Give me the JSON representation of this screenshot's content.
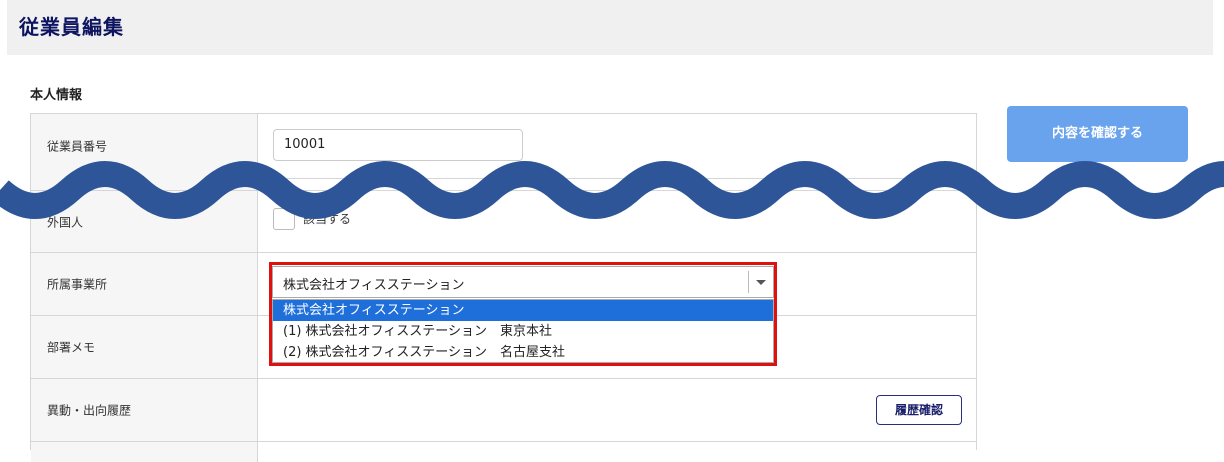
{
  "page": {
    "title": "従業員編集"
  },
  "section": {
    "title": "本人情報"
  },
  "actions": {
    "confirm_label": "内容を確認する"
  },
  "form": {
    "employee_number": {
      "label": "従業員番号",
      "value": "10001"
    },
    "foreigner": {
      "label": "外国人",
      "checkbox_label": "該当する",
      "checked": false
    },
    "office": {
      "label": "所属事業所",
      "selected": "株式会社オフィスステーション",
      "options": [
        "株式会社オフィスステーション",
        "(1) 株式会社オフィスステーション　東京本社",
        "(2) 株式会社オフィスステーション　名古屋支社"
      ]
    },
    "department_memo": {
      "label": "部署メモ"
    },
    "transfer_history": {
      "label": "異動・出向履歴",
      "button_label": "履歴確認"
    }
  },
  "colors": {
    "title": "#0e1560",
    "confirm_button": "#69a3ee",
    "selected_option": "#1e6fd9",
    "highlight": "#e01010",
    "wave": "#2e5597"
  }
}
